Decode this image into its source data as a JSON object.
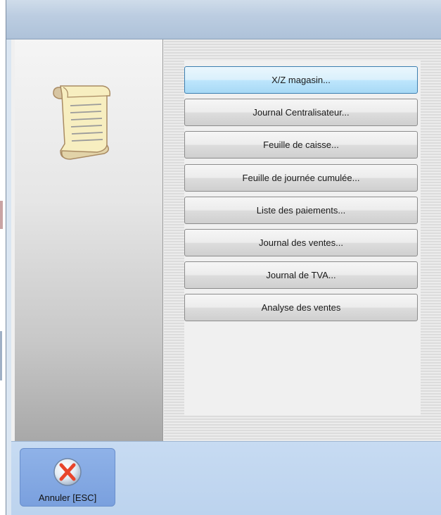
{
  "menu": {
    "items": [
      {
        "label": "X/Z magasin...",
        "selected": true
      },
      {
        "label": "Journal Centralisateur...",
        "selected": false
      },
      {
        "label": "Feuille de caisse...",
        "selected": false
      },
      {
        "label": "Feuille de journée cumulée...",
        "selected": false
      },
      {
        "label": "Liste des paiements...",
        "selected": false
      },
      {
        "label": "Journal des ventes...",
        "selected": false
      },
      {
        "label": "Journal de TVA...",
        "selected": false
      },
      {
        "label": "Analyse des ventes",
        "selected": false
      }
    ]
  },
  "footer": {
    "cancel_label": "Annuler [ESC]",
    "cancel_icon": "cancel-x-icon"
  },
  "header": {
    "icon": "scroll-document-icon"
  },
  "colors": {
    "selected_button": "#bee6fd",
    "cancel_button": "#7aa0de",
    "cancel_x": "#e8452c"
  }
}
